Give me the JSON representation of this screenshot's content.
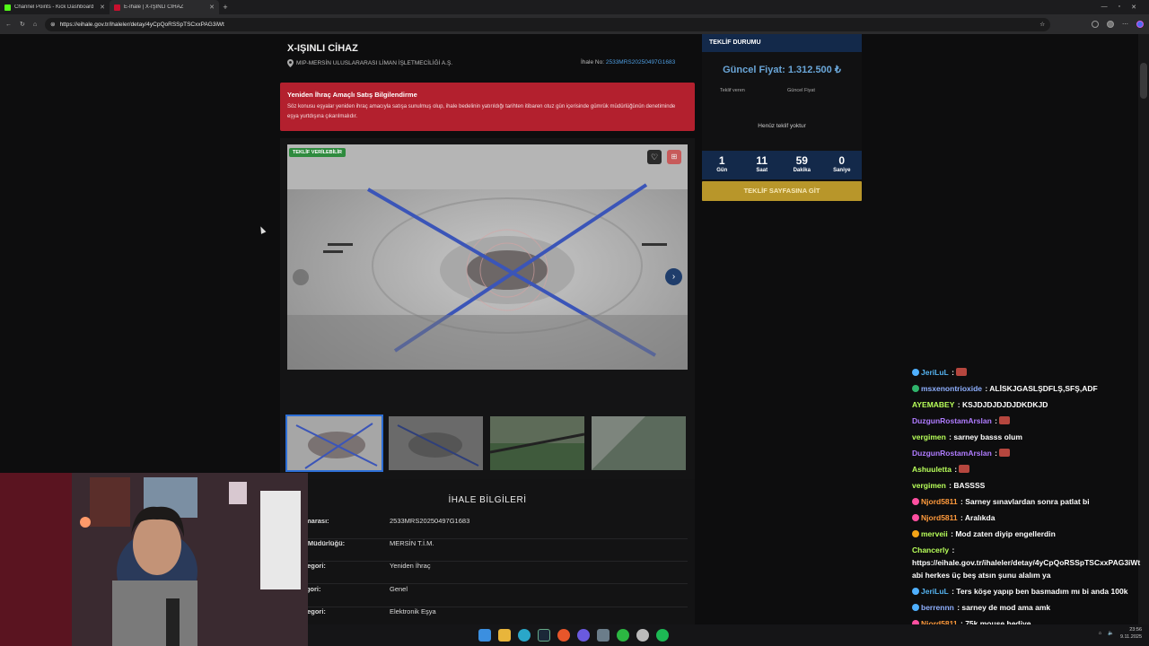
{
  "browser": {
    "tabs": [
      {
        "title": "Channel Points - Kick Dashboard",
        "active": false,
        "favicon_color": "#53fc18"
      },
      {
        "title": "E-İhale | X-IŞINLI CİHAZ",
        "active": true,
        "favicon_color": "#c8102e"
      }
    ],
    "new_tab": "+",
    "url": "https://eihale.gov.tr/ihaleler/detay/4yCpQoRSSpTSCxxPAG3iWt"
  },
  "listing": {
    "title": "X-IŞINLI CİHAZ",
    "org": "MIP-MERSİN ULUSLARARASI LİMAN İŞLETMECİLİĞİ A.Ş.",
    "ihale_no_label": "İhale No:",
    "ihale_no": "2533MRS20250497G1683",
    "alert_title": "Yeniden İhraç Amaçlı Satış Bilgilendirme",
    "alert_body": "Söz konusu eşyalar yeniden ihraç amacıyla satışa sunulmuş olup, ihale bedelinin yatırıldığı tarihten itibaren otuz gün içerisinde gümrük müdürlüğünün denetiminde eşya yurtdışına çıkarılmalıdır.",
    "badge": "TEKLİF VERİLEBİLİR",
    "info_heading": "İHALE BİLGİLERİ",
    "info_rows": [
      {
        "k": "Numarası:",
        "v": "2533MRS20250497G1683"
      },
      {
        "k": "me Müdürlüğü:",
        "v": "MERSİN T.İ.M."
      },
      {
        "k": "Kategori:",
        "v": "Yeniden İhraç"
      },
      {
        "k": "ategori:",
        "v": "Genel"
      },
      {
        "k": "Kategori:",
        "v": "Elektronik Eşya"
      }
    ]
  },
  "offer": {
    "heading": "TEKLİF DURUMU",
    "price": "Güncel Fiyat: 1.312.500 ₺",
    "col1": "Teklif veren",
    "col2": "Güncel Fiyat",
    "empty": "Henüz teklif yoktur",
    "countdown": [
      {
        "n": "1",
        "l": "Gün"
      },
      {
        "n": "11",
        "l": "Saat"
      },
      {
        "n": "59",
        "l": "Dakika"
      },
      {
        "n": "0",
        "l": "Saniye"
      }
    ],
    "button": "TEKLİF SAYFASINA GİT"
  },
  "chat": [
    {
      "user": "JeriLuL",
      "color": "#55b3f0",
      "text": "",
      "badge": "#4fb0ff"
    },
    {
      "user": "msxenontrioxide",
      "color": "#8fb0ff",
      "text": "ALİSKJGASLŞDFLŞ,SFŞ,ADF",
      "badge": "#2fb36b"
    },
    {
      "user": "AYEMABEY",
      "color": "#b8ff5a",
      "text": "KSJDJDJDJDJDKDKJD",
      "badge": ""
    },
    {
      "user": "DuzgunRostamArslan",
      "color": "#b07cff",
      "text": "",
      "badge": ""
    },
    {
      "user": "vergimen",
      "color": "#b8ff5a",
      "text": "sarney basss olum",
      "badge": ""
    },
    {
      "user": "DuzgunRostamArslan",
      "color": "#b07cff",
      "text": "",
      "badge": ""
    },
    {
      "user": "Ashuuletta",
      "color": "#b8ff5a",
      "text": "",
      "badge": ""
    },
    {
      "user": "vergimen",
      "color": "#b8ff5a",
      "text": "BASSSS",
      "badge": ""
    },
    {
      "user": "Njord5811",
      "color": "#ff9a3c",
      "text": "Sarney sınavlardan sonra patlat bi",
      "badge": "#ff4fa0"
    },
    {
      "user": "Njord5811",
      "color": "#ff9a3c",
      "text": "Aralıkda",
      "badge": "#ff4fa0"
    },
    {
      "user": "merveii",
      "color": "#b8ff5a",
      "text": "Mod zaten diyip engellerdin",
      "badge": "#f4a417"
    },
    {
      "user": "Chancerly",
      "color": "#b8ff5a",
      "text": "https://eihale.gov.tr/ihaleler/detay/4yCpQoRSSpTSCxxPAG3iWt abi herkes üç beş atsın şunu alalım ya",
      "badge": "",
      "wrap": true
    },
    {
      "user": "JeriLuL",
      "color": "#55b3f0",
      "text": "Ters köşe yapıp ben basmadım mı bi anda 100k",
      "badge": "#4fb0ff",
      "wrap": true
    },
    {
      "user": "berrennn",
      "color": "#8fb0ff",
      "text": "sarney de mod ama amk",
      "badge": "#4fb0ff"
    },
    {
      "user": "Njord5811",
      "color": "#ff9a3c",
      "text": "75k mouse hediye",
      "badge": "#ff4fa0"
    }
  ],
  "taskbar": {
    "time": "23:56",
    "date": "9.11.2025"
  }
}
